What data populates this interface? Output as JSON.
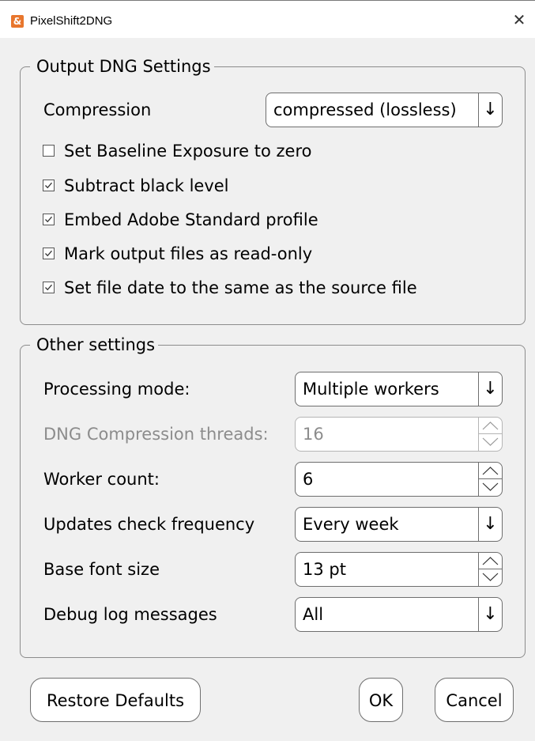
{
  "window": {
    "title": "PixelShift2DNG",
    "app_icon_glyph": "&",
    "close_glyph": "✕"
  },
  "output_group": {
    "title": "Output DNG Settings",
    "compression_label": "Compression",
    "compression_value": "compressed (lossless)",
    "checkboxes": [
      {
        "label": "Set Baseline Exposure to zero",
        "checked": false
      },
      {
        "label": "Subtract black level",
        "checked": true
      },
      {
        "label": "Embed Adobe Standard profile",
        "checked": true
      },
      {
        "label": "Mark output files as read-only",
        "checked": true
      },
      {
        "label": "Set file date to the same as the source file",
        "checked": true
      }
    ]
  },
  "other_group": {
    "title": "Other settings",
    "rows": [
      {
        "label": "Processing mode:",
        "value": "Multiple workers",
        "kind": "combo",
        "disabled": false
      },
      {
        "label": "DNG Compression threads:",
        "value": "16",
        "kind": "spin",
        "disabled": true
      },
      {
        "label": "Worker count:",
        "value": "6",
        "kind": "spin",
        "disabled": false
      },
      {
        "label": "Updates check frequency",
        "value": "Every week",
        "kind": "combo",
        "disabled": false
      },
      {
        "label": "Base font size",
        "value": "13 pt",
        "kind": "spin",
        "disabled": false
      },
      {
        "label": "Debug log messages",
        "value": "All",
        "kind": "combo",
        "disabled": false
      }
    ]
  },
  "buttons": {
    "restore_defaults": "Restore Defaults",
    "ok": "OK",
    "cancel": "Cancel"
  },
  "icons": {
    "dropdown_arrow": "↓"
  }
}
